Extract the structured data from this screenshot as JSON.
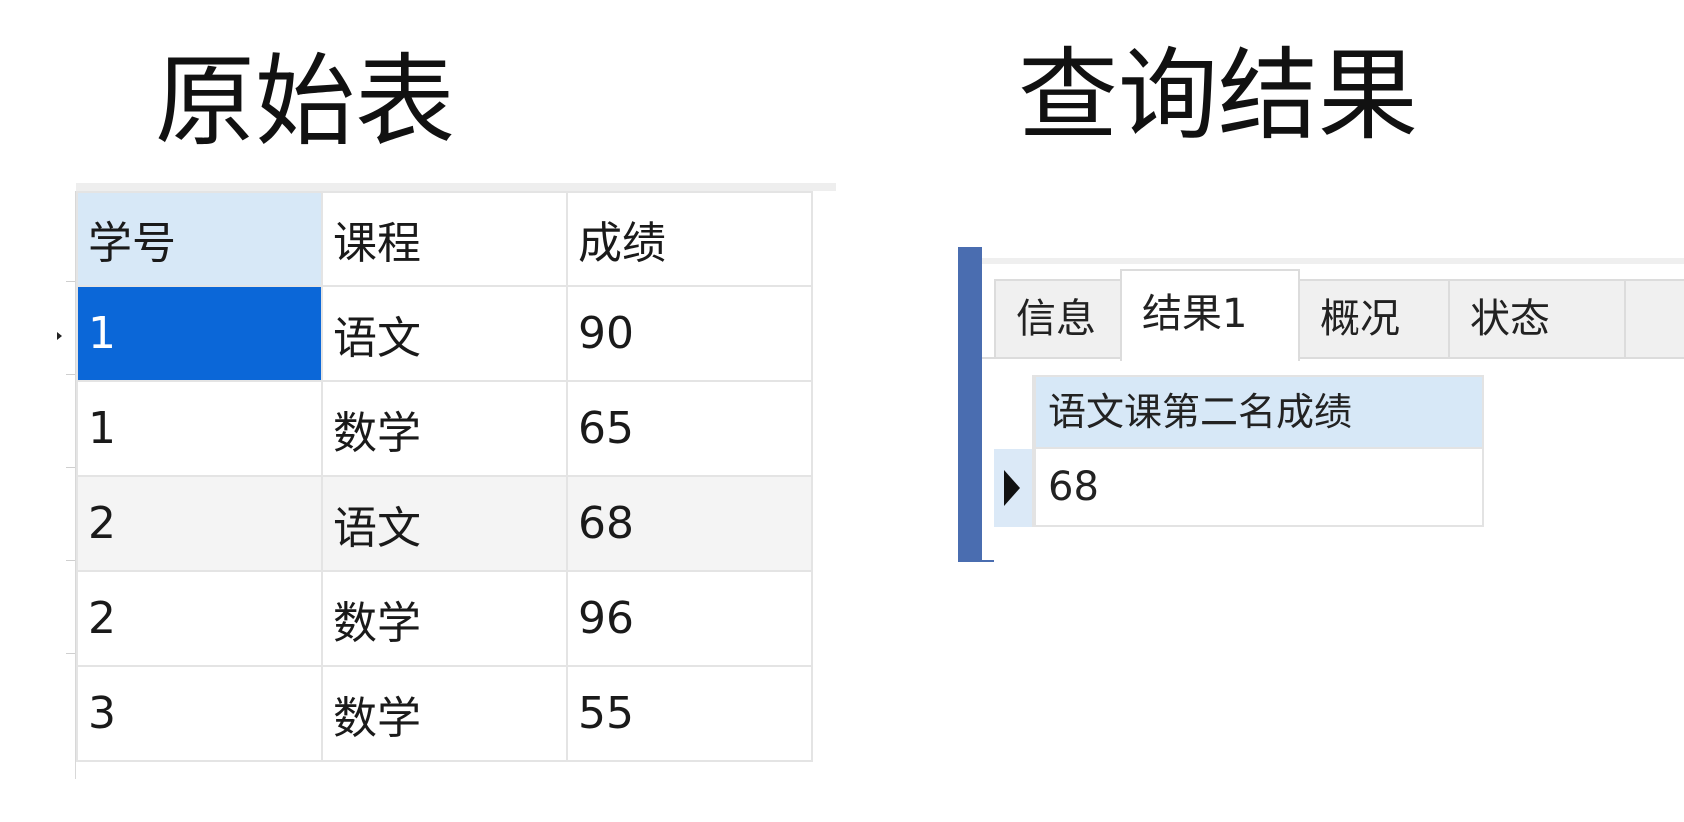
{
  "titles": {
    "original": "原始表",
    "result": "查询结果"
  },
  "original_table": {
    "columns": [
      "学号",
      "课程",
      "成绩"
    ],
    "rows": [
      [
        "1",
        "语文",
        "90"
      ],
      [
        "1",
        "数学",
        "65"
      ],
      [
        "2",
        "语文",
        "68"
      ],
      [
        "2",
        "数学",
        "96"
      ],
      [
        "3",
        "数学",
        "55"
      ]
    ],
    "selected_row": 0,
    "selected_column": "学号"
  },
  "query_result": {
    "tabs": [
      "信息",
      "结果1",
      "概况",
      "状态"
    ],
    "active_tab": "结果1",
    "column": "语文课第二名成绩",
    "value": "68"
  },
  "colors": {
    "selection": "#0b67d8",
    "header_highlight": "#d7e8f7",
    "panel_accent": "#4a6db0"
  }
}
